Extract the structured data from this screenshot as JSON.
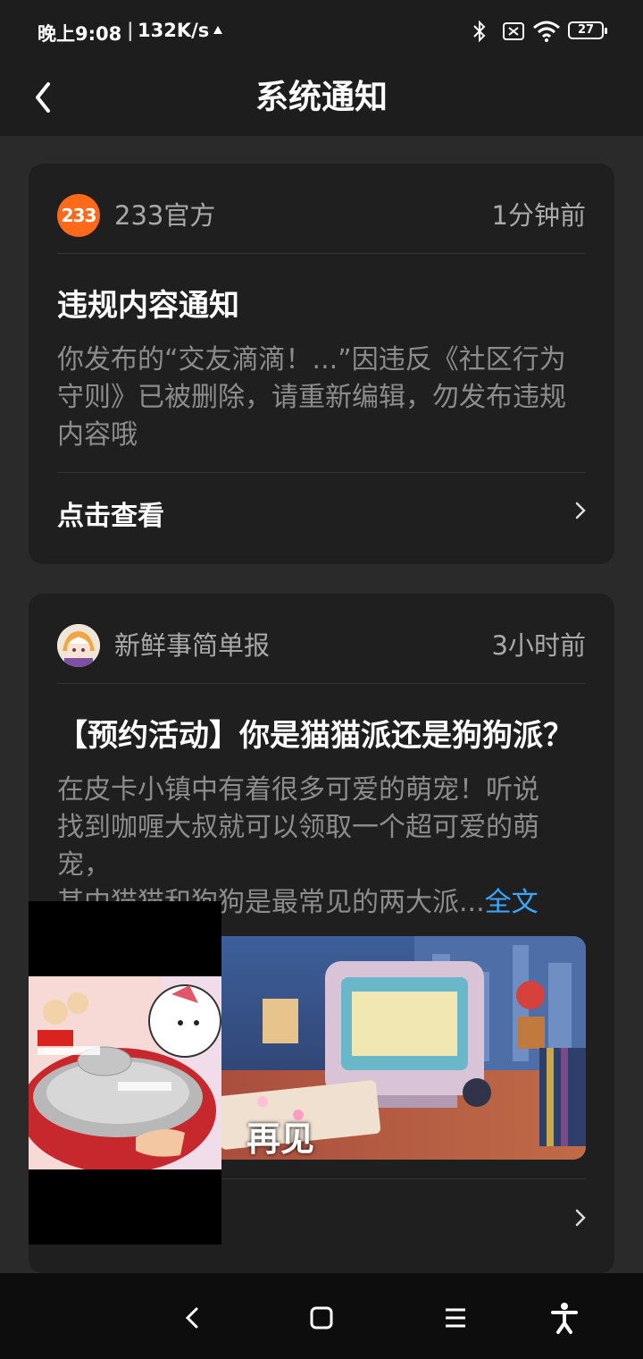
{
  "status_bar": {
    "time": "晚上9:08",
    "separator": "|",
    "network_speed": "132K/s",
    "battery_level": "27",
    "icons": [
      "notification-icon",
      "bluetooth-icon",
      "sim-icon",
      "wifi-icon",
      "battery-icon"
    ]
  },
  "header": {
    "title": "系统通知",
    "back_icon": "chevron-left-icon"
  },
  "notifications": [
    {
      "avatar_text": "233",
      "sender": "233官方",
      "time": "1分钟前",
      "title": "违规内容通知",
      "body": "你发布的“交友滴滴！...”因违反《社区行为守则》已被删除，请重新编辑，勿发布违规内容哦",
      "action_label": "点击查看"
    },
    {
      "sender": "新鲜事简单报",
      "time": "3小时前",
      "title": "【预约活动】你是猫猫派还是狗狗派？",
      "body_lines": [
        "在皮卡小镇中有着很多可爱的萌宠！听说",
        "找到咖喱大叔就可以领取一个超可爱的萌",
        "宠，",
        "其中猫猫和狗狗是最常见的两大派..."
      ],
      "full_text_link": "全文",
      "banner_caption": "再见"
    }
  ],
  "colors": {
    "background": "#2a2a2a",
    "card": "#1f1f1f",
    "accent_link": "#3ca7ff",
    "avatar_233": "#ff6a1a"
  },
  "system_nav": [
    "back-icon",
    "home-icon",
    "menu-icon",
    "accessibility-icon"
  ]
}
